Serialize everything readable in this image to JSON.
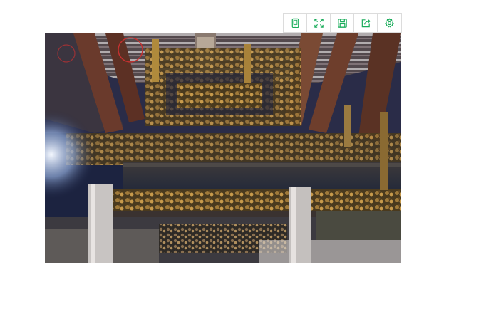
{
  "viewer": {
    "accent_color": "#1aad5b",
    "toolbar": {
      "buttons": [
        {
          "icon": "phone-icon",
          "action": "mobile-view"
        },
        {
          "icon": "fullscreen-icon",
          "action": "fullscreen"
        },
        {
          "icon": "save-icon",
          "action": "save"
        },
        {
          "icon": "share-icon",
          "action": "share"
        },
        {
          "icon": "gear-icon",
          "action": "settings"
        }
      ]
    },
    "image": {
      "subject": "carved-gilded-wooden-roof-beams-photo"
    }
  }
}
